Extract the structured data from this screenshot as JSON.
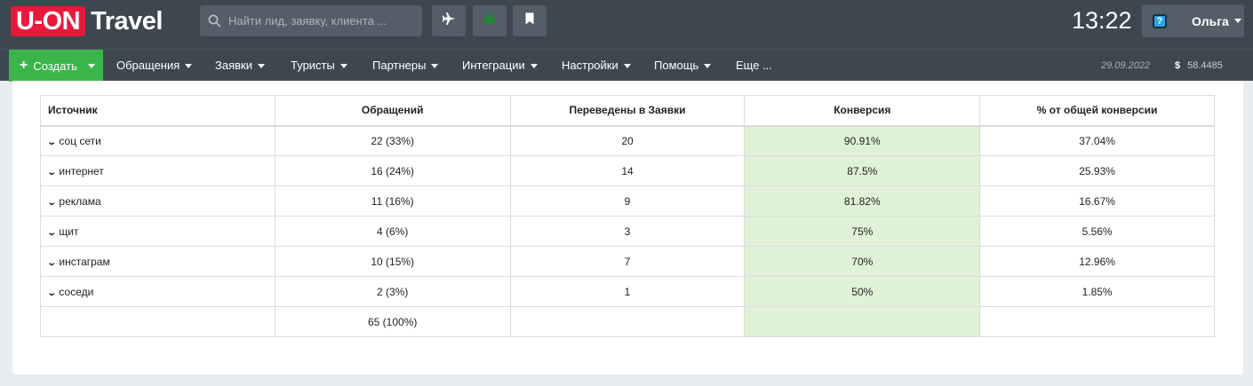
{
  "header": {
    "logo_box": "U-ON",
    "logo_text": "Travel",
    "search_placeholder": "Найти лид, заявку, клиента ...",
    "clock": "13:22",
    "user_name": "Ольга"
  },
  "nav": {
    "create_label": "Создать",
    "items": [
      "Обращения",
      "Заявки",
      "Туристы",
      "Партнеры",
      "Интеграции",
      "Настройки",
      "Помощь",
      "Еще ..."
    ],
    "date": "29.09.2022",
    "currency_symbol": "$",
    "rate": "58.4485"
  },
  "table": {
    "headers": [
      "Источник",
      "Обращений",
      "Переведены в Заявки",
      "Конверсия",
      "% от общей конверсии"
    ],
    "rows": [
      {
        "source": "соц сети",
        "requests": "22 (33%)",
        "converted": "20",
        "conversion": "90.91%",
        "share": "37.04%"
      },
      {
        "source": "интернет",
        "requests": "16 (24%)",
        "converted": "14",
        "conversion": "87.5%",
        "share": "25.93%"
      },
      {
        "source": "реклама",
        "requests": "11 (16%)",
        "converted": "9",
        "conversion": "81.82%",
        "share": "16.67%"
      },
      {
        "source": "щит",
        "requests": "4 (6%)",
        "converted": "3",
        "conversion": "75%",
        "share": "5.56%"
      },
      {
        "source": "инстаграм",
        "requests": "10 (15%)",
        "converted": "7",
        "conversion": "70%",
        "share": "12.96%"
      },
      {
        "source": "соседи",
        "requests": "2 (3%)",
        "converted": "1",
        "conversion": "50%",
        "share": "1.85%"
      }
    ],
    "total": {
      "source": "",
      "requests": "65 (100%)",
      "converted": "",
      "conversion": "",
      "share": ""
    }
  },
  "colors": {
    "header_bg": "#3d4750",
    "create_green": "#3bb54a",
    "logo_red": "#e8193c",
    "conversion_highlight": "#dff2d8"
  }
}
